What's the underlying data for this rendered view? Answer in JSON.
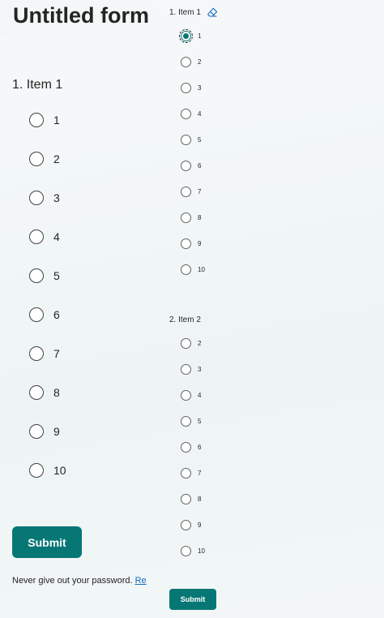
{
  "form": {
    "title": "Untitled form"
  },
  "left": {
    "question": {
      "title": "1. Item 1",
      "options": [
        "1",
        "2",
        "3",
        "4",
        "5",
        "6",
        "7",
        "8",
        "9",
        "10"
      ]
    },
    "submit_label": "Submit",
    "footer": {
      "text": "Never give out your password.",
      "link": "Re"
    }
  },
  "right": {
    "question1": {
      "title": "1. Item 1",
      "selected": "1",
      "options": [
        "1",
        "2",
        "3",
        "4",
        "5",
        "6",
        "7",
        "8",
        "9",
        "10"
      ]
    },
    "question2": {
      "title": "2. Item 2",
      "options": [
        "2",
        "3",
        "4",
        "5",
        "6",
        "7",
        "8",
        "9",
        "10"
      ]
    },
    "submit_label": "Submit"
  },
  "icons": {
    "clear": "eraser-icon"
  },
  "colors": {
    "accent": "#077775",
    "link": "#0f6cbd",
    "text": "#242424"
  }
}
